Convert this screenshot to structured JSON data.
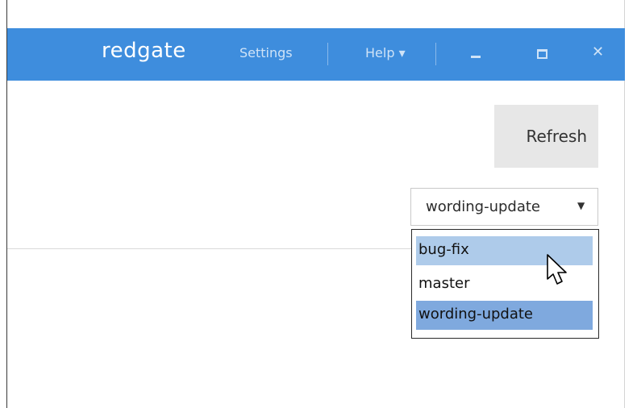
{
  "titlebar": {
    "logo": "redgate",
    "settings_label": "Settings",
    "help_label": "Help ▾",
    "accent_color": "#3e8ddd",
    "minimize_icon": "minimize-icon",
    "maximize_icon": "maximize-icon",
    "close_icon": "close-icon"
  },
  "toolbar": {
    "refresh_label": "Refresh"
  },
  "branch_select": {
    "value": "wording-update",
    "options": [
      "bug-fix",
      "master",
      "wording-update"
    ],
    "hovered": "bug-fix",
    "selected": "wording-update"
  }
}
